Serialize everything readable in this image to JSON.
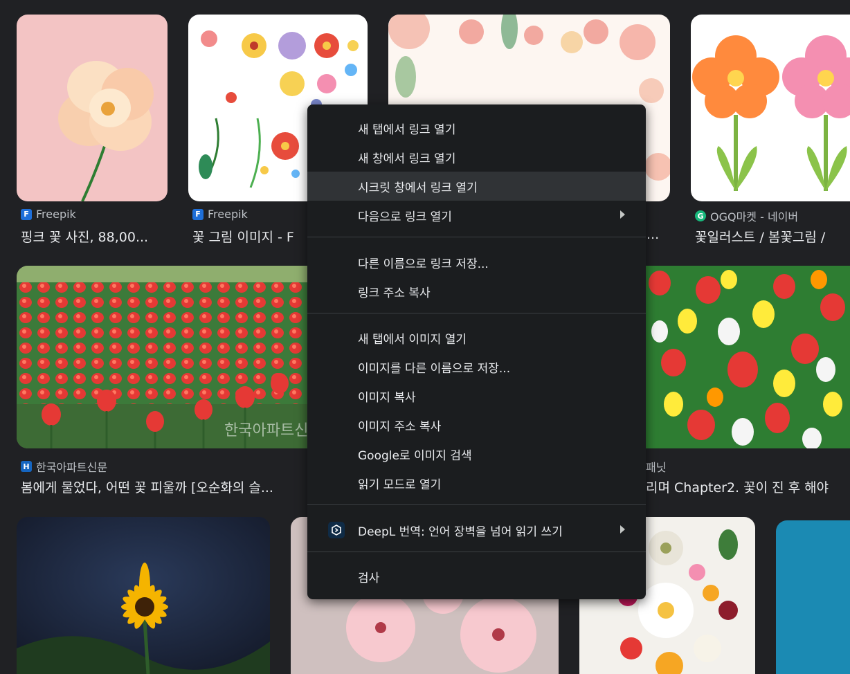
{
  "results": [
    {
      "source": "Freepik",
      "title": "핑크 꽃 사진, 88,00...",
      "favicon": "freepik-icon"
    },
    {
      "source": "Freepik",
      "title": "꽃 그림 이미지 - F",
      "favicon": "freepik-icon"
    },
    {
      "source": "",
      "title": "...",
      "favicon": ""
    },
    {
      "source": "OGQ마켓 - 네이버",
      "title": "꽃일러스트 / 봄꽃그림 /",
      "favicon": "ogq-icon"
    },
    {
      "source": "한국아파트신문",
      "title": "봄에게 물었다, 어떤 꽃 피울까 [오순화의 슬...",
      "favicon": "h-icon"
    },
    {
      "source": "패닛",
      "title": "리며 Chapter2. 꽃이 진 후 해야",
      "favicon": ""
    }
  ],
  "context_menu": {
    "items": [
      {
        "label": "새 탭에서 링크 열기"
      },
      {
        "label": "새 창에서 링크 열기"
      },
      {
        "label": "시크릿 창에서 링크 열기"
      },
      {
        "label": "다음으로 링크 열기"
      },
      {
        "label": "다른 이름으로 링크 저장..."
      },
      {
        "label": "링크 주소 복사"
      },
      {
        "label": "새 탭에서 이미지 열기"
      },
      {
        "label": "이미지를 다른 이름으로 저장..."
      },
      {
        "label": "이미지 복사"
      },
      {
        "label": "이미지 주소 복사"
      },
      {
        "label": "Google로 이미지 검색"
      },
      {
        "label": "읽기 모드로 열기"
      },
      {
        "label": "DeepL 번역: 언어 장벽을 넘어 읽기  쓰기"
      },
      {
        "label": "검사"
      }
    ]
  },
  "watermark": "한국아파트신",
  "colors": {
    "background": "#202124",
    "menu": "#1b1d1f",
    "highlight": "#303336",
    "separator": "#3c4043"
  }
}
